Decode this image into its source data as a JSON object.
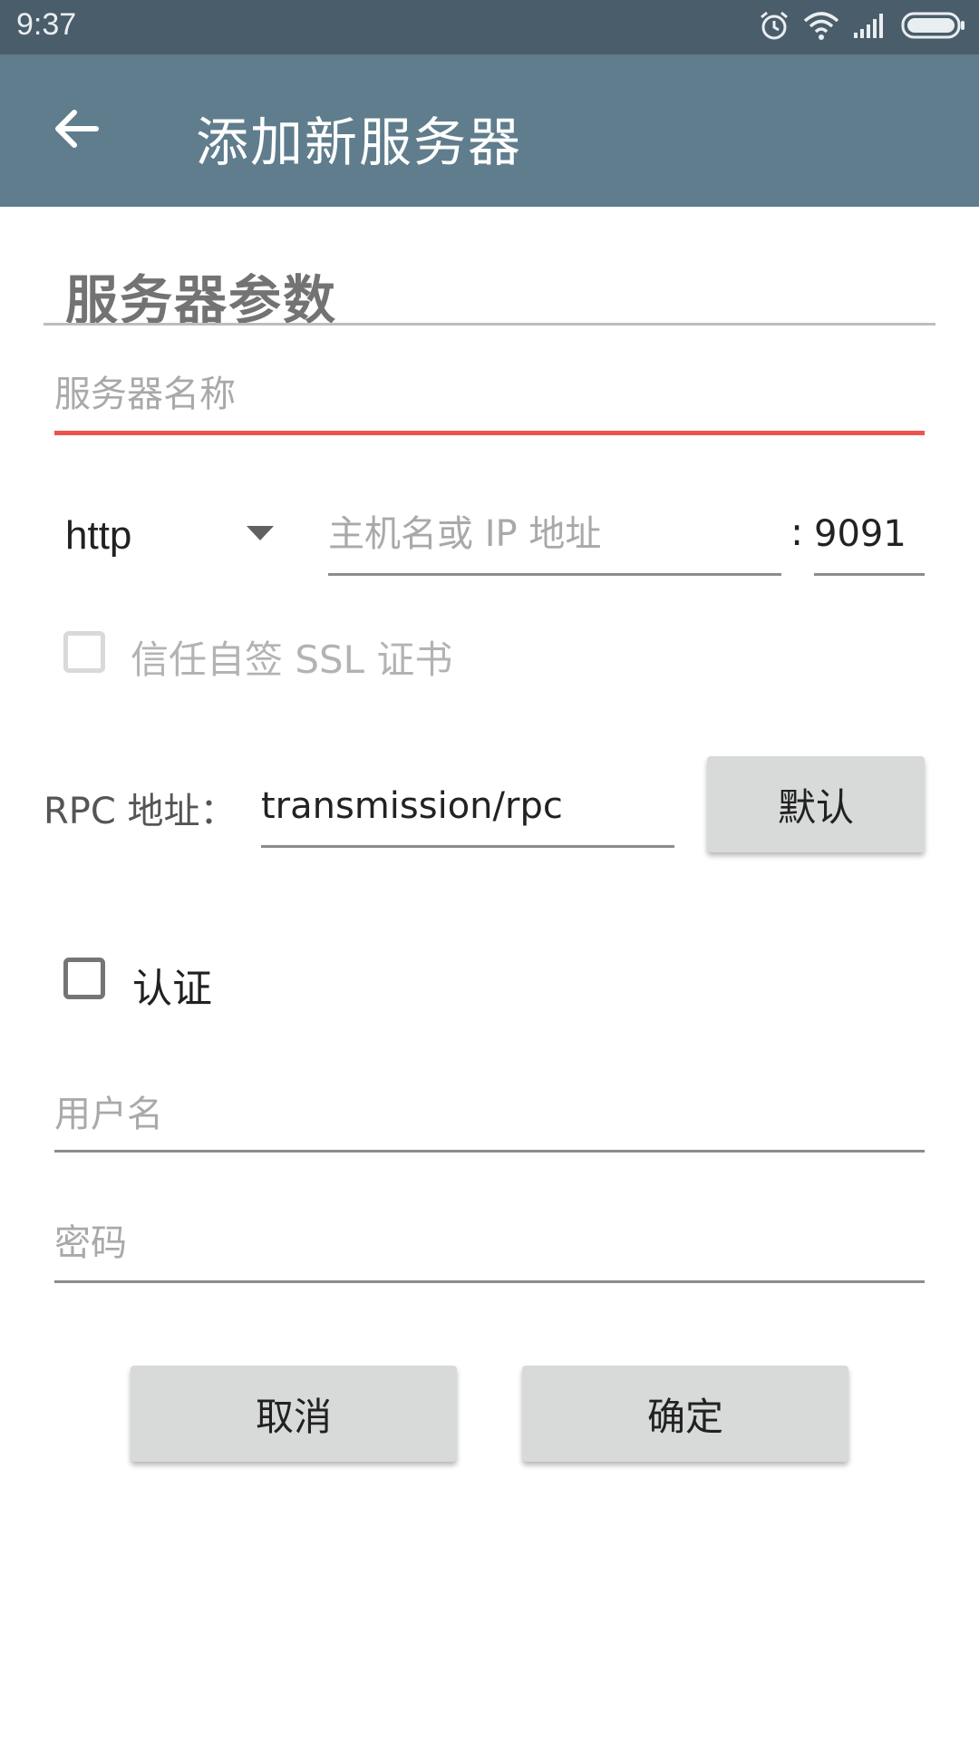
{
  "status_bar": {
    "time": "9:37",
    "icons": [
      "alarm-icon",
      "wifi-icon",
      "signal-icon",
      "battery-icon"
    ]
  },
  "app_bar": {
    "back_icon": "arrow-left-icon",
    "title": "添加新服务器",
    "background_color": "#5f7d8c"
  },
  "section": {
    "title": "服务器参数"
  },
  "server_name": {
    "placeholder": "服务器名称",
    "value": "",
    "underline_color": "#ef5350"
  },
  "protocol": {
    "selected": "http",
    "dropdown_icon": "triangle-down-icon"
  },
  "host": {
    "placeholder": "主机名或 IP 地址",
    "value": ""
  },
  "port": {
    "separator": ":",
    "value": "9091"
  },
  "ssl": {
    "label": "信任自签 SSL 证书",
    "checked": false,
    "enabled": false
  },
  "rpc": {
    "label": "RPC 地址：",
    "value": "transmission/rpc",
    "default_button": "默认"
  },
  "auth": {
    "label": "认证",
    "checked": false
  },
  "username": {
    "placeholder": "用户名",
    "value": ""
  },
  "password": {
    "placeholder": "密码",
    "value": ""
  },
  "actions": {
    "cancel": "取消",
    "ok": "确定"
  }
}
